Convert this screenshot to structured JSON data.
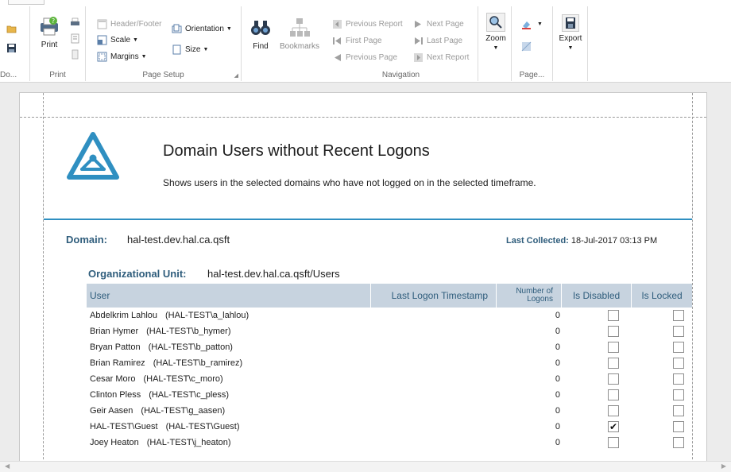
{
  "ribbon": {
    "doc_group_label": "Do...",
    "print_group": {
      "label": "Print",
      "print_button": "Print"
    },
    "page_setup": {
      "label": "Page Setup",
      "header_footer": "Header/Footer",
      "scale": "Scale",
      "margins": "Margins",
      "orientation": "Orientation",
      "size": "Size"
    },
    "find_group": {
      "find": "Find",
      "bookmarks": "Bookmarks"
    },
    "navigation": {
      "label": "Navigation",
      "previous_report": "Previous Report",
      "first_page": "First Page",
      "previous_page": "Previous Page",
      "next_page": "Next Page",
      "last_page": "Last Page",
      "next_report": "Next Report"
    },
    "zoom": {
      "label": "Zoom"
    },
    "page_group": {
      "label": "Page..."
    },
    "export": {
      "label": "Export"
    }
  },
  "report": {
    "title": "Domain Users without Recent Logons",
    "description": "Shows users in the selected domains who have not logged on in the selected timeframe.",
    "domain_label": "Domain:",
    "domain_value": "hal-test.dev.hal.ca.qsft",
    "last_collected_label": "Last Collected:",
    "last_collected_value": "18-Jul-2017 03:13 PM",
    "ou_label": "Organizational Unit:",
    "ou_value": "hal-test.dev.hal.ca.qsft/Users",
    "columns": {
      "user": "User",
      "last_logon": "Last Logon Timestamp",
      "logons_line1": "Number of",
      "logons_line2": "Logons",
      "disabled": "Is Disabled",
      "locked": "Is Locked"
    },
    "rows": [
      {
        "name": "Abdelkrim Lahlou",
        "account": "(HAL-TEST\\a_lahlou)",
        "last_logon": "",
        "logons": "0",
        "disabled": "",
        "locked": ""
      },
      {
        "name": "Brian Hymer",
        "account": "(HAL-TEST\\b_hymer)",
        "last_logon": "",
        "logons": "0",
        "disabled": "",
        "locked": ""
      },
      {
        "name": "Bryan Patton",
        "account": "(HAL-TEST\\b_patton)",
        "last_logon": "",
        "logons": "0",
        "disabled": "",
        "locked": ""
      },
      {
        "name": "Brian Ramirez",
        "account": "(HAL-TEST\\b_ramirez)",
        "last_logon": "",
        "logons": "0",
        "disabled": "",
        "locked": ""
      },
      {
        "name": "Cesar Moro",
        "account": "(HAL-TEST\\c_moro)",
        "last_logon": "",
        "logons": "0",
        "disabled": "",
        "locked": ""
      },
      {
        "name": "Clinton Pless",
        "account": "(HAL-TEST\\c_pless)",
        "last_logon": "",
        "logons": "0",
        "disabled": "",
        "locked": ""
      },
      {
        "name": "Geir Aasen",
        "account": "(HAL-TEST\\g_aasen)",
        "last_logon": "",
        "logons": "0",
        "disabled": "",
        "locked": ""
      },
      {
        "name": "HAL-TEST\\Guest",
        "account": "(HAL-TEST\\Guest)",
        "last_logon": "",
        "logons": "0",
        "disabled": "✔",
        "locked": ""
      },
      {
        "name": "Joey Heaton",
        "account": "(HAL-TEST\\j_heaton)",
        "last_logon": "",
        "logons": "0",
        "disabled": "",
        "locked": ""
      }
    ]
  },
  "colors": {
    "accent": "#2f8fc1",
    "label_text": "#2f5d7c",
    "header_fill": "#c7d3df"
  }
}
